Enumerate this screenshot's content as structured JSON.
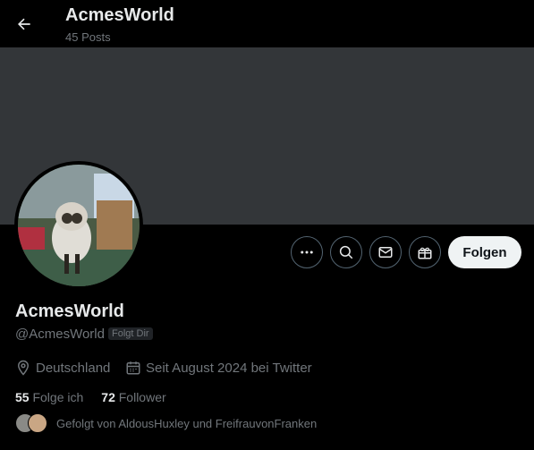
{
  "header": {
    "title": "AcmesWorld",
    "post_count": "45 Posts"
  },
  "actions": {
    "follow_label": "Folgen"
  },
  "profile": {
    "name": "AcmesWorld",
    "handle": "@AcmesWorld",
    "follows_you_badge": "Folgt Dir",
    "location": "Deutschland",
    "joined": "Seit August 2024 bei Twitter",
    "following_count": "55",
    "following_label": "Folge ich",
    "followers_count": "72",
    "followers_label": "Follower",
    "followed_by": "Gefolgt von AldousHuxley und FreifrauvonFranken"
  },
  "colors": {
    "background": "#000000",
    "banner": "#333639",
    "text_primary": "#e7e9ea",
    "text_secondary": "#71767b",
    "follow_button_bg": "#eff3f4"
  },
  "icons": [
    "back-arrow-icon",
    "more-icon",
    "search-icon",
    "mail-icon",
    "gift-icon",
    "location-pin-icon",
    "calendar-icon"
  ]
}
